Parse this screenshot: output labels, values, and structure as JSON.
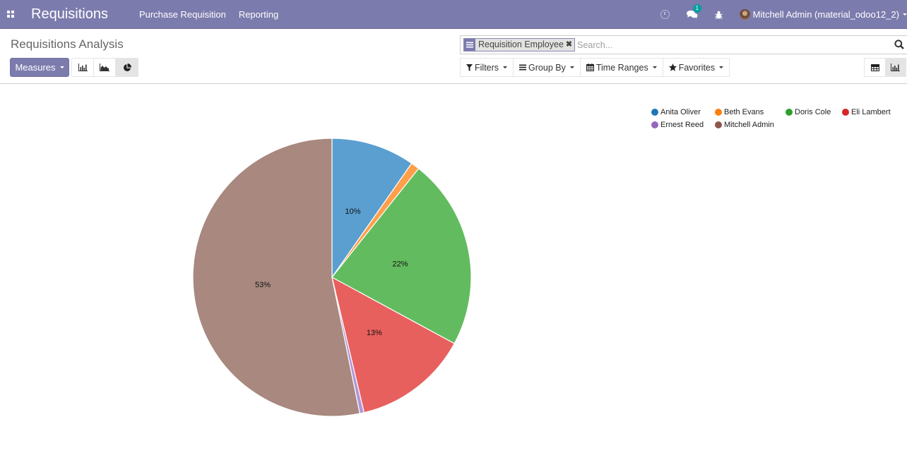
{
  "navbar": {
    "app_title": "Requisitions",
    "menu": [
      "Purchase Requisition",
      "Reporting"
    ],
    "chat_badge": "1",
    "user": "Mitchell Admin (material_odoo12_2)"
  },
  "control_panel": {
    "breadcrumb": "Requisitions Analysis",
    "measures_label": "Measures",
    "search": {
      "facet_value": "Requisition Employee",
      "placeholder": "Search..."
    },
    "filters_label": "Filters",
    "group_by_label": "Group By",
    "time_ranges_label": "Time Ranges",
    "favorites_label": "Favorites",
    "active_chart_type": "pie",
    "active_view": "graph"
  },
  "chart_data": {
    "type": "pie",
    "title": "",
    "categories": [
      "Anita Oliver",
      "Beth Evans",
      "Doris Cole",
      "Eli Lambert",
      "Ernest Reed",
      "Mitchell Admin"
    ],
    "values": [
      9.7,
      1.0,
      22.2,
      13.4,
      0.5,
      53.2
    ],
    "labels": [
      "10%",
      "",
      "22%",
      "13%",
      "",
      "53%"
    ],
    "colors": [
      "#5a9fcf",
      "#ff9f4a",
      "#62bb5e",
      "#e7605d",
      "#b396d6",
      "#a8887f"
    ],
    "legend_colors": [
      "#1f77b4",
      "#ff7f0e",
      "#2ca02c",
      "#d62728",
      "#9467bd",
      "#8c564b"
    ],
    "legend_position": "top-right",
    "start": "top",
    "direction": "clockwise"
  }
}
